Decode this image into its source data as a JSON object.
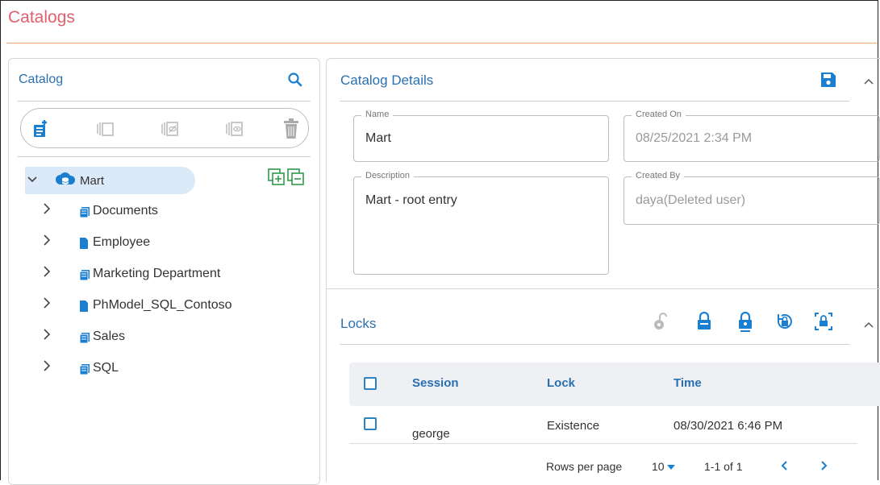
{
  "page": {
    "title": "Catalogs"
  },
  "catalog_panel": {
    "title": "Catalog",
    "search_icon": "search-icon",
    "toolbar": [
      "new-catalog-icon",
      "checkout-icon",
      "hide-icon",
      "show-icon",
      "delete-icon"
    ],
    "root": {
      "label": "Mart",
      "icon": "database-icon",
      "expanded": true
    },
    "items": [
      {
        "label": "Documents",
        "icon": "folder-icon"
      },
      {
        "label": "Employee",
        "icon": "file-icon"
      },
      {
        "label": "Marketing Department",
        "icon": "folder-icon"
      },
      {
        "label": "PhModel_SQL_Contoso",
        "icon": "file-icon"
      },
      {
        "label": "Sales",
        "icon": "folder-icon"
      },
      {
        "label": "SQL",
        "icon": "folder-icon"
      }
    ]
  },
  "details": {
    "title": "Catalog Details",
    "name": {
      "label": "Name",
      "value": "Mart"
    },
    "description": {
      "label": "Description",
      "value": "Mart - root entry"
    },
    "created_on": {
      "label": "Created On",
      "value": "08/25/2021 2:34 PM"
    },
    "created_by": {
      "label": "Created By",
      "value": "daya(Deleted user)"
    }
  },
  "locks": {
    "title": "Locks",
    "columns": [
      "Session",
      "Lock",
      "Time"
    ],
    "rows": [
      {
        "session": "george",
        "lock": "Existence",
        "time": "08/30/2021 6:46 PM"
      }
    ],
    "pagination": {
      "rows_per_page_label": "Rows per page",
      "rows_per_page": "10",
      "range": "1-1 of 1"
    }
  },
  "colors": {
    "accent": "#2a6fb0",
    "title": "#e0606e",
    "icon_blue": "#1a7fd0"
  }
}
